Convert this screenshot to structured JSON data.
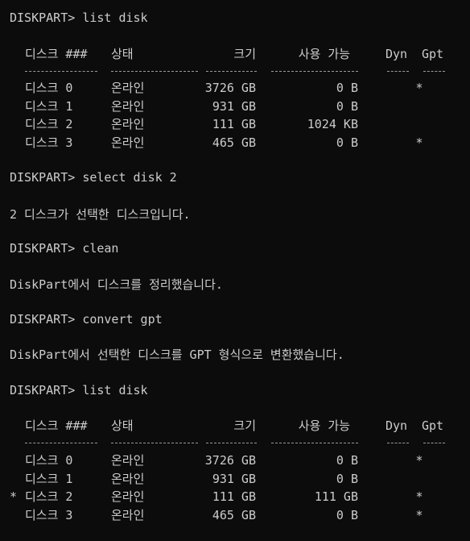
{
  "window": {
    "background": "#0c0c0c",
    "text_color": "#cccccc"
  },
  "commands": [
    {
      "prompt": "DISKPART> ",
      "command": "list disk"
    },
    {
      "prompt": "DISKPART> ",
      "command": "select disk 2"
    },
    {
      "prompt": "DISKPART> ",
      "command": "clean"
    },
    {
      "prompt": "DISKPART> ",
      "command": "convert gpt"
    },
    {
      "prompt": "DISKPART> ",
      "command": "list disk"
    }
  ],
  "messages": [
    "2 디스크가 선택한 디스크입니다.",
    "DiskPart에서 디스크를 정리했습니다.",
    "DiskPart에서 선택한 디스크를 GPT 형식으로 변환했습니다."
  ],
  "table_headers": {
    "disk": "디스크 ###",
    "status": "상태",
    "size": "크기",
    "free": "사용 가능",
    "dyn": "Dyn",
    "gpt": "Gpt"
  },
  "table1": [
    {
      "marker": "",
      "disk": "디스크 0",
      "status": "온라인",
      "size": "3726 GB",
      "free": "0 B",
      "dyn": "",
      "gpt": "*"
    },
    {
      "marker": "",
      "disk": "디스크 1",
      "status": "온라인",
      "size": "931 GB",
      "free": "0 B",
      "dyn": "",
      "gpt": ""
    },
    {
      "marker": "",
      "disk": "디스크 2",
      "status": "온라인",
      "size": "111 GB",
      "free": "1024 KB",
      "dyn": "",
      "gpt": ""
    },
    {
      "marker": "",
      "disk": "디스크 3",
      "status": "온라인",
      "size": "465 GB",
      "free": "0 B",
      "dyn": "",
      "gpt": "*"
    }
  ],
  "table2": [
    {
      "marker": "",
      "disk": "디스크 0",
      "status": "온라인",
      "size": "3726 GB",
      "free": "0 B",
      "dyn": "",
      "gpt": "*"
    },
    {
      "marker": "",
      "disk": "디스크 1",
      "status": "온라인",
      "size": "931 GB",
      "free": "0 B",
      "dyn": "",
      "gpt": ""
    },
    {
      "marker": "*",
      "disk": "디스크 2",
      "status": "온라인",
      "size": "111 GB",
      "free": "111 GB",
      "dyn": "",
      "gpt": "*"
    },
    {
      "marker": "",
      "disk": "디스크 3",
      "status": "온라인",
      "size": "465 GB",
      "free": "0 B",
      "dyn": "",
      "gpt": "*"
    }
  ]
}
